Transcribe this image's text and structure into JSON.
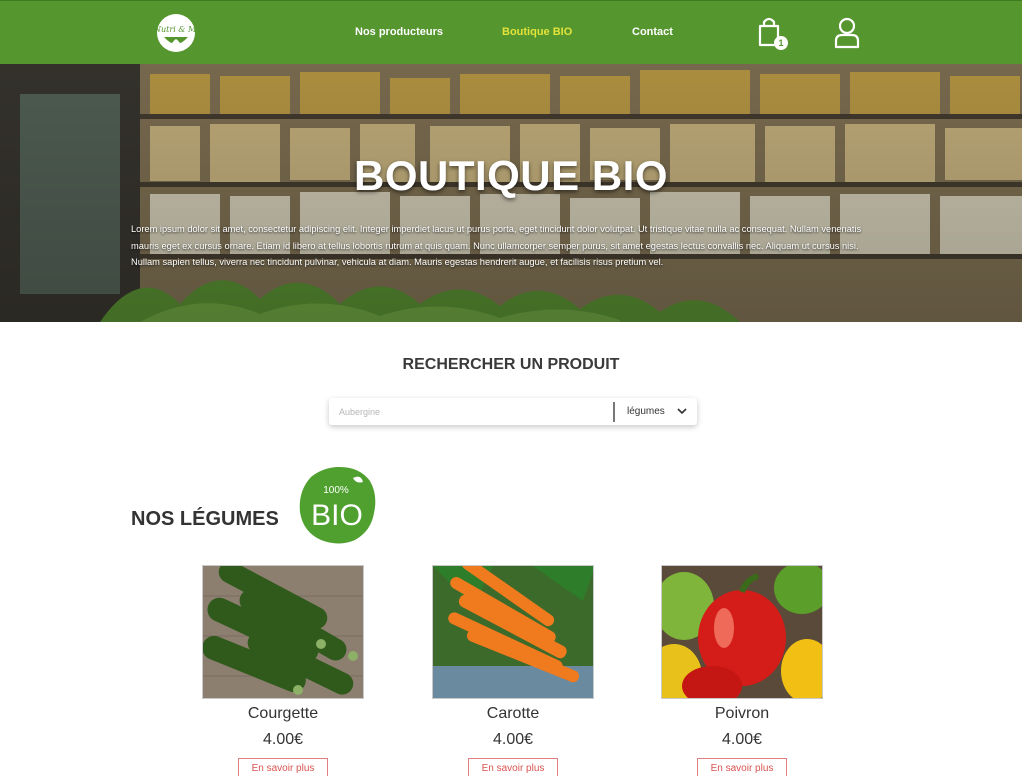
{
  "header": {
    "logo_text": "Nutri & Me",
    "nav": [
      {
        "label": "Nos producteurs",
        "active": false
      },
      {
        "label": "Boutique BIO",
        "active": true
      },
      {
        "label": "Contact",
        "active": false
      }
    ],
    "cart_count": "1",
    "colors": {
      "bar": "#55962f",
      "active_link": "#e3e339"
    },
    "icons": [
      "shopping-bag-icon",
      "user-icon"
    ]
  },
  "hero": {
    "title": "BOUTIQUE BIO",
    "text": "Lorem ipsum dolor sit amet, consectetur adipiscing elit. Integer imperdiet lacus ut purus porta, eget tincidunt dolor volutpat. Ut tristique vitae nulla ac consequat. Nullam venenatis mauris  eget ex cursus ornare. Etiam id libero at tellus lobortis rutrum at quis quam. Nunc ullamcorper  semper purus, sit amet egestas lectus convallis nec. Aliquam ut cursus nisi. Nullam sapien tellus, viverra nec tincidunt pulvinar, vehicula at diam. Mauris egestas hendrerit augue, et facilisis risus pretium vel."
  },
  "search": {
    "title": "RECHERCHER UN PRODUIT",
    "placeholder": "Aubergine",
    "category": "légumes"
  },
  "section": {
    "title": "NOS LÉGUMES",
    "badge_top": "100%",
    "badge_main": "BIO"
  },
  "products": [
    {
      "name": "Courgette",
      "price": "4.00€",
      "button": "En savoir plus"
    },
    {
      "name": "Carotte",
      "price": "4.00€",
      "button": "En savoir plus"
    },
    {
      "name": "Poivron",
      "price": "4.00€",
      "button": "En savoir plus"
    }
  ]
}
